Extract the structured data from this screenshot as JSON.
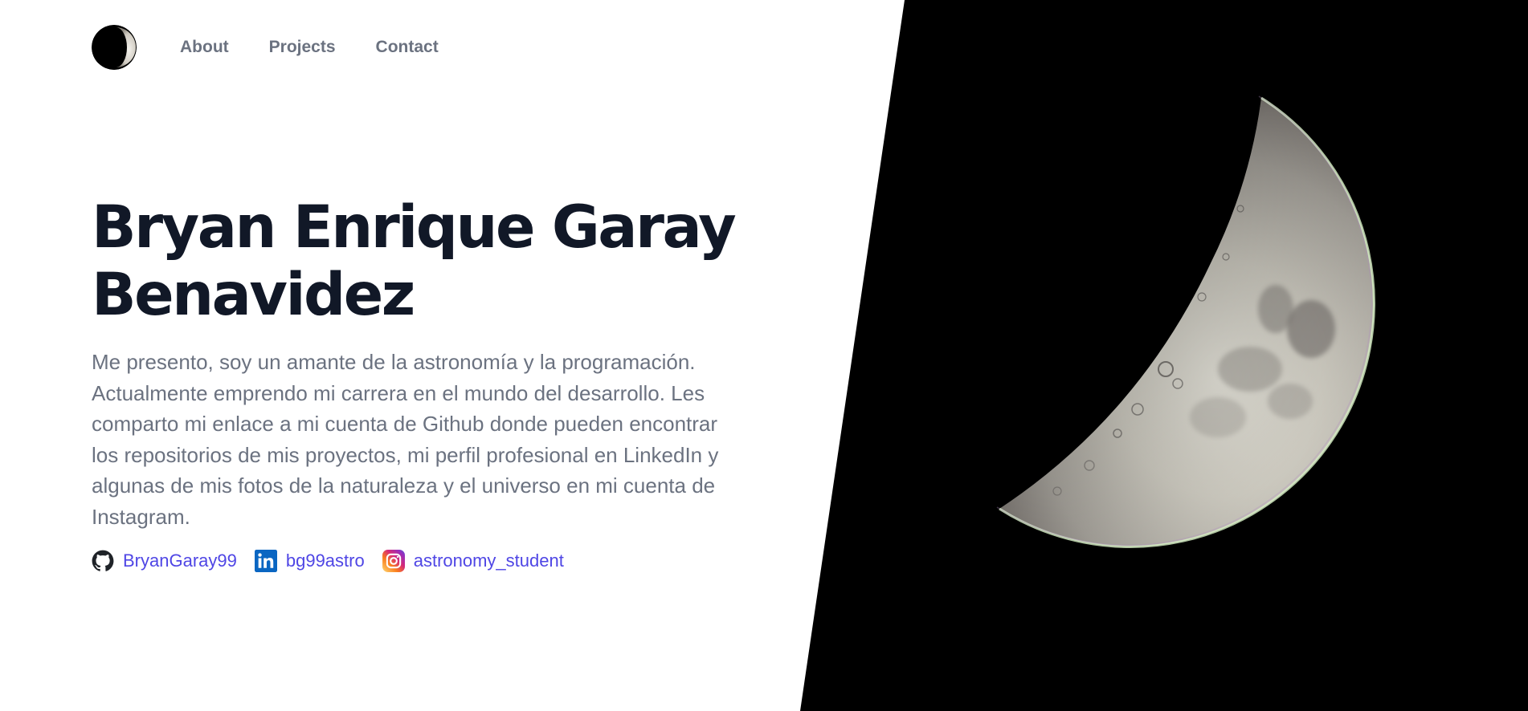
{
  "nav": {
    "logo_icon": "moon-logo-icon",
    "links": [
      {
        "label": "About"
      },
      {
        "label": "Projects"
      },
      {
        "label": "Contact"
      }
    ]
  },
  "hero": {
    "title_line1": "Bryan Enrique Garay",
    "title_line2": "Benavidez",
    "description": "Me presento, soy un amante de la astronomía y la programación. Actualmente emprendo mi carrera en el mundo del desarrollo. Les comparto mi enlace a mi cuenta de Github donde pueden encontrar los repositorios de mis proyectos, mi perfil profesional en LinkedIn y algunas de mis fotos de la naturaleza y el universo en mi cuenta de Instagram."
  },
  "social": [
    {
      "icon": "github-icon",
      "label": "BryanGaray99"
    },
    {
      "icon": "linkedin-icon",
      "label": "bg99astro"
    },
    {
      "icon": "instagram-icon",
      "label": "astronomy_student"
    }
  ],
  "colors": {
    "title": "#111827",
    "body_text": "#6b7280",
    "link": "#4f46e5",
    "linkedin": "#0a66c2",
    "image_background": "#000000"
  },
  "image": {
    "subject": "moon-photo"
  }
}
